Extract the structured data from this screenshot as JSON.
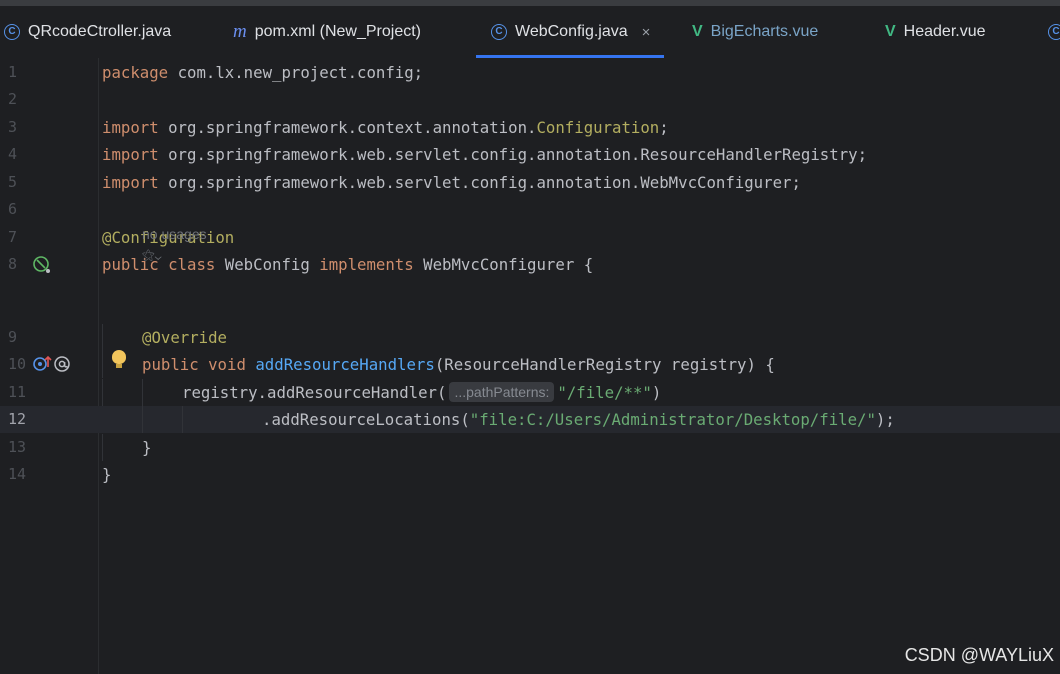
{
  "tabs": [
    {
      "label": "QRcodeCtroller.java",
      "icon": "java-class-icon",
      "active": false
    },
    {
      "label": "pom.xml (New_Project)",
      "icon": "maven-icon",
      "active": false
    },
    {
      "label": "WebConfig.java",
      "icon": "java-class-icon",
      "active": true,
      "close": "×"
    },
    {
      "label": "BigEcharts.vue",
      "icon": "vue-icon",
      "active": false
    },
    {
      "label": "Header.vue",
      "icon": "vue-icon",
      "active": false
    }
  ],
  "lines": [
    {
      "n": "1",
      "t1": "package",
      "t2": " com.lx.new_project.config;"
    },
    {
      "n": "2"
    },
    {
      "n": "3",
      "t1": "import",
      "t2": " org.springframework.context.annotation.",
      "t3": "Configuration",
      "t4": ";"
    },
    {
      "n": "4",
      "t1": "import",
      "t2": " org.springframework.web.servlet.config.annotation.ResourceHandlerRegistry;"
    },
    {
      "n": "5",
      "t1": "import",
      "t2": " org.springframework.web.servlet.config.annotation.WebMvcConfigurer;"
    },
    {
      "n": "6"
    },
    {
      "n": "7",
      "t1": "@Configuration"
    },
    {
      "n": "8",
      "t1": "public class",
      "t2": " WebConfig ",
      "t3": "implements",
      "t4": " WebMvcConfigurer {"
    },
    {
      "n": "9",
      "t1": "@Override"
    },
    {
      "n": "10",
      "t1": "public void",
      "t2": " ",
      "t3": "addResourceHandlers",
      "t4": "(ResourceHandlerRegistry registry) {"
    },
    {
      "n": "11",
      "t1": "registry.addResourceHandler(",
      "hint": "...pathPatterns:",
      "t2": "\"/file/**\"",
      "t3": ")"
    },
    {
      "n": "12",
      "t1": ".addResourceLocations(",
      "t2": "\"file:C:/Users/Administrator/Desktop/file/\"",
      "t3": ");"
    },
    {
      "n": "13",
      "t1": "}"
    },
    {
      "n": "14",
      "t1": "}"
    }
  ],
  "no_usages": "no usages",
  "ai_icon_label": "⚝⌄",
  "watermark": "CSDN @WAYLiuX",
  "colors": {
    "keyword": "#cf8e6d",
    "annotation": "#b3ae60",
    "method": "#56a8f5",
    "string": "#6aab73",
    "text": "#bcbec4",
    "accent": "#3574f0"
  }
}
